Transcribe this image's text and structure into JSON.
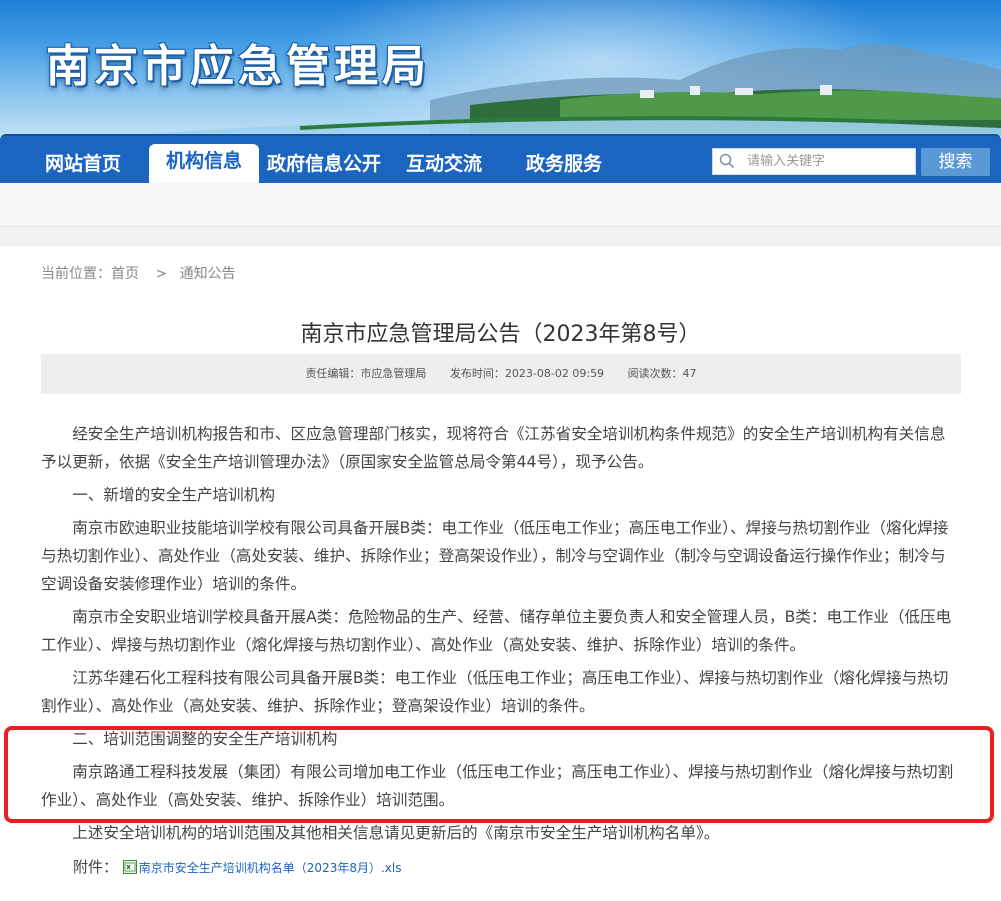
{
  "header": {
    "site_title": "南京市应急管理局"
  },
  "nav": {
    "items": [
      {
        "label": "网站首页"
      },
      {
        "label": "机构信息"
      },
      {
        "label": "政府信息公开"
      },
      {
        "label": "互动交流"
      },
      {
        "label": "政务服务"
      }
    ],
    "active_index": 1,
    "search": {
      "placeholder": "请输入关键字",
      "button_label": "搜索"
    }
  },
  "breadcrumb": {
    "prefix": "当前位置：",
    "home": "首页",
    "separator": ">",
    "current": "通知公告"
  },
  "article": {
    "title": "南京市应急管理局公告（2023年第8号）",
    "meta": {
      "editor": "责任编辑：市应急管理局",
      "published": "发布时间：2023-08-02 09:59",
      "views": "阅读次数：47"
    },
    "paragraphs": [
      "经安全生产培训机构报告和市、区应急管理部门核实，现将符合《江苏省安全培训机构条件规范》的安全生产培训机构有关信息予以更新，依据《安全生产培训管理办法》（原国家安全监管总局令第44号），现予公告。",
      "一、新增的安全生产培训机构",
      "南京市欧迪职业技能培训学校有限公司具备开展B类：电工作业（低压电工作业；高压电工作业）、焊接与热切割作业（熔化焊接与热切割作业）、高处作业（高处安装、维护、拆除作业；登高架设作业），制冷与空调作业（制冷与空调设备运行操作作业；制冷与空调设备安装修理作业）培训的条件。",
      "南京市全安职业培训学校具备开展A类：危险物品的生产、经营、储存单位主要负责人和安全管理人员，B类：电工作业（低压电工作业）、焊接与热切割作业（熔化焊接与热切割作业）、高处作业（高处安装、维护、拆除作业）培训的条件。",
      "江苏华建石化工程科技有限公司具备开展B类：电工作业（低压电工作业；高压电工作业）、焊接与热切割作业（熔化焊接与热切割作业）、高处作业（高处安装、维护、拆除作业；登高架设作业）培训的条件。",
      "二、培训范围调整的安全生产培训机构",
      "南京路通工程科技发展（集团）有限公司增加电工作业（低压电工作业；高压电工作业）、焊接与热切割作业（熔化焊接与热切割作业）、高处作业（高处安装、维护、拆除作业）培训范围。",
      "上述安全培训机构的培训范围及其他相关信息请见更新后的《南京市安全生产培训机构名单》。"
    ],
    "attachment": {
      "label": "附件：",
      "file_name": "南京市安全生产培训机构名单（2023年8月）.xls",
      "icon": "excel-file-icon"
    }
  },
  "colors": {
    "nav_blue": "#1b65c1",
    "highlight_red": "#e8201f"
  }
}
